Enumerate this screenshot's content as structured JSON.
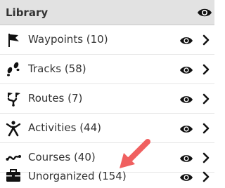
{
  "library": {
    "title": "Library"
  },
  "items": [
    {
      "label": "Waypoints (10)",
      "icon": "flag-icon"
    },
    {
      "label": "Tracks (58)",
      "icon": "footprints-icon"
    },
    {
      "label": "Routes (7)",
      "icon": "route-icon"
    },
    {
      "label": "Activities (44)",
      "icon": "person-activity-icon"
    },
    {
      "label": "Courses (40)",
      "icon": "course-squiggle-icon"
    },
    {
      "label": "Unorganized (154)",
      "icon": "briefcase-icon"
    }
  ],
  "colors": {
    "header_bg": "#e2e2e2",
    "text": "#333333",
    "icon": "#111111",
    "pointer_arrow": "#f06060"
  }
}
